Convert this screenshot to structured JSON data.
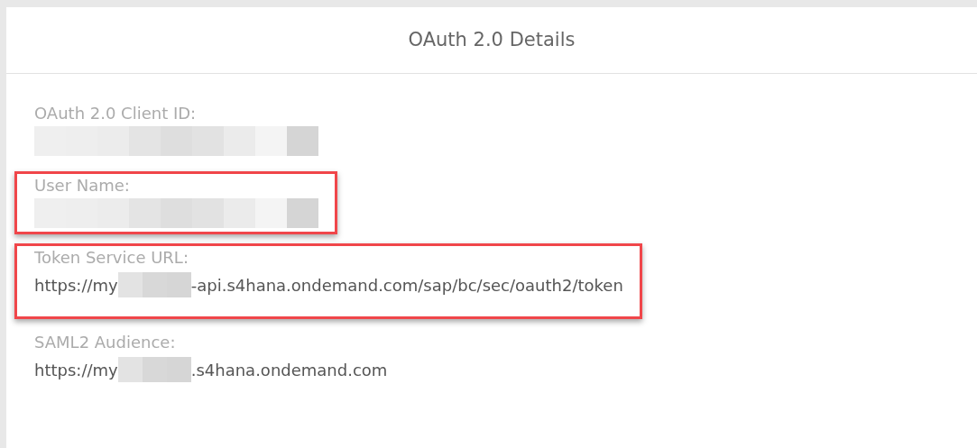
{
  "dialog": {
    "title": "OAuth 2.0 Details"
  },
  "fields": [
    {
      "label": "OAuth 2.0 Client ID:",
      "highlighted": false,
      "value": [
        {
          "kind": "redacted"
        }
      ]
    },
    {
      "label": "User Name:",
      "highlighted": true,
      "value": [
        {
          "kind": "redacted"
        }
      ]
    },
    {
      "label": "Token Service URL:",
      "highlighted": true,
      "value": [
        {
          "kind": "text",
          "text": "https://my"
        },
        {
          "kind": "redacted"
        },
        {
          "kind": "text",
          "text": "-api.s4hana.ondemand.com/sap/bc/sec/oauth2/token"
        }
      ]
    },
    {
      "label": "SAML2 Audience:",
      "highlighted": false,
      "value": [
        {
          "kind": "text",
          "text": "https://my"
        },
        {
          "kind": "redacted"
        },
        {
          "kind": "text",
          "text": ".s4hana.ondemand.com"
        }
      ]
    }
  ]
}
